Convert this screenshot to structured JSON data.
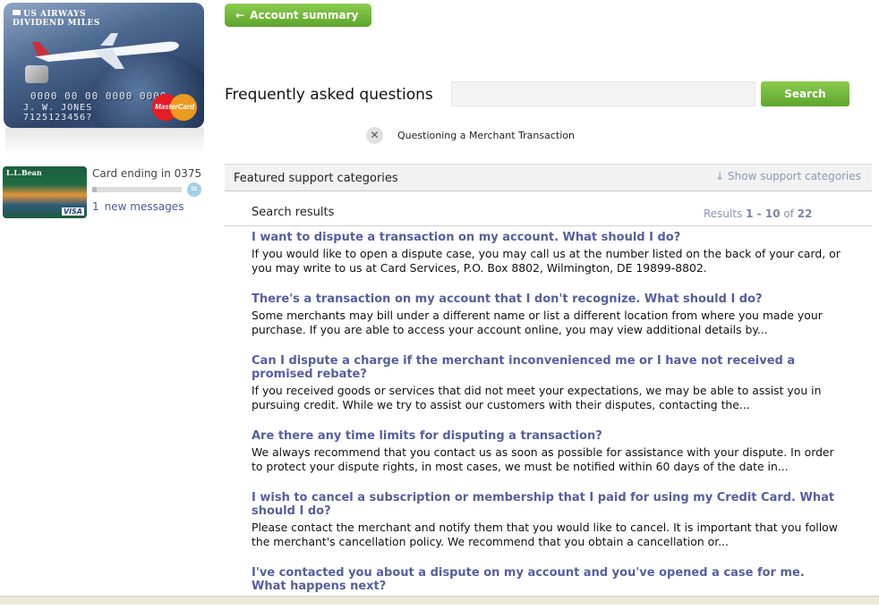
{
  "left": {
    "main_card": {
      "brand_line1": "US AIRWAYS",
      "brand_line2": "DIVIDEND MILES",
      "card_number": "0000 00 00 0000 0000",
      "holder_name": "J. W. JONES",
      "holder_number": "7125123456?",
      "network": "MasterCard"
    },
    "mini_card": {
      "brand": "L.L.Bean",
      "network": "VISA"
    },
    "card_ending": "Card ending in 0375",
    "progress_fraction": 0.05,
    "message_count": "1",
    "message_label": "new messages"
  },
  "header": {
    "back_label": "Account summary",
    "faq_title": "Frequently asked questions",
    "search_placeholder": "",
    "search_label": "Search",
    "active_filter": "Questioning a Merchant Transaction"
  },
  "featured": {
    "label": "Featured support categories",
    "toggle_label": "Show support categories"
  },
  "results_meta": {
    "heading": "Search results",
    "prefix": "Results",
    "range": "1 - 10",
    "of": "of",
    "total": "22"
  },
  "results": [
    {
      "question": "I want to dispute a transaction on my account. What should I do?",
      "answer": "If you would like to open a dispute case, you may call us at the number listed on the back of your card, or you may write to us at Card Services, P.O. Box 8802, Wilmington, DE 19899-8802."
    },
    {
      "question": "There's a transaction on my account that I don't recognize. What should I do?",
      "answer": "Some merchants may bill under a different name or list a different location from where you made your purchase. If you are able to access your account online, you may view additional details by..."
    },
    {
      "question": "Can I dispute a charge if the merchant inconvenienced me or I have not received a promised rebate?",
      "answer": "If you received goods or services that did not meet your expectations, we may be able to assist you in pursuing credit. While we try to assist our customers with their disputes, contacting the..."
    },
    {
      "question": "Are there any time limits for disputing a transaction?",
      "answer": "We always recommend that you contact us as soon as possible for assistance with your dispute. In order to protect your dispute rights, in most cases, we must be notified within 60 days of the date in..."
    },
    {
      "question": "I wish to cancel a subscription or membership that I paid for using my Credit Card. What should I do?",
      "answer": "Please contact the merchant and notify them that you would like to cancel. It is important that you follow the merchant's cancellation policy. We recommend that you obtain a cancellation or..."
    },
    {
      "question": "I've contacted you about a dispute on my account and you've opened a case for me. What happens next?",
      "answer": ""
    }
  ],
  "colors": {
    "accent_green": "#6db33f",
    "link_blue": "#555f9e"
  },
  "icons": {
    "back": "arrow-left-icon",
    "clear": "close-circle-icon",
    "toggle": "arrow-down-icon"
  }
}
